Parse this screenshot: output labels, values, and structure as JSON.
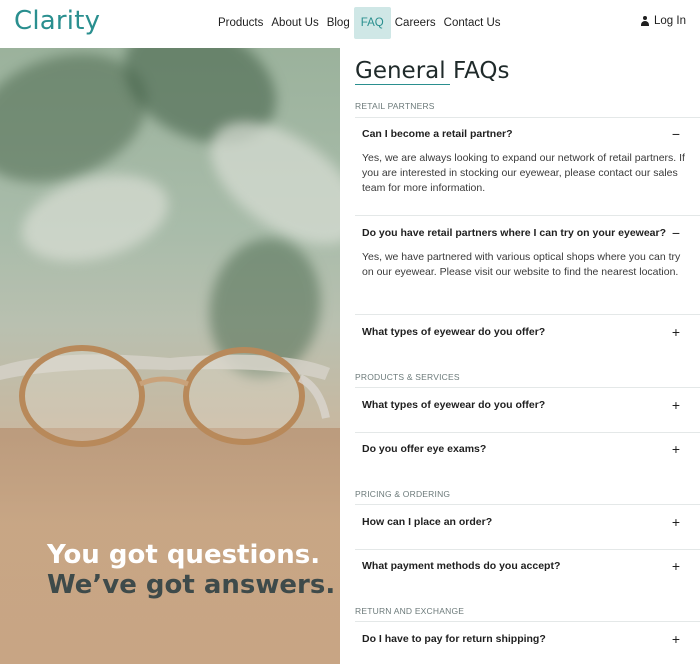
{
  "header": {
    "logo": "Clarity",
    "nav": [
      "Products",
      "About Us",
      "Blog",
      "FAQ",
      "Careers",
      "Contact Us"
    ],
    "active_nav": "FAQ",
    "login": "Log In"
  },
  "hero": {
    "line1": "You got questions.",
    "line2": "We’ve got answers."
  },
  "faq": {
    "title": "General FAQs",
    "sections": [
      {
        "label": "RETAIL PARTNERS",
        "items": [
          {
            "question": "Can I become a retail partner?",
            "expanded": true,
            "toggle": "−",
            "answer": "Yes, we are always looking to expand our network of retail partners. If you are interested in stocking our eyewear, please contact our sales team for more information."
          },
          {
            "question": "Do you have retail partners where I can try on your eyewear?",
            "expanded": true,
            "toggle": "−",
            "answer": "Yes, we have partnered with various optical shops where you can try on our eyewear. Please visit our website to find the nearest location."
          },
          {
            "question": "What types of eyewear do you offer?",
            "expanded": false,
            "toggle": "+"
          }
        ]
      },
      {
        "label": "PRODUCTS & SERVICES",
        "items": [
          {
            "question": "What types of eyewear do you offer?",
            "expanded": false,
            "toggle": "+"
          },
          {
            "question": "Do you offer eye exams?",
            "expanded": false,
            "toggle": "+"
          }
        ]
      },
      {
        "label": "PRICING & ORDERING",
        "items": [
          {
            "question": "How can I place an order?",
            "expanded": false,
            "toggle": "+"
          },
          {
            "question": "What payment methods do you accept?",
            "expanded": false,
            "toggle": "+"
          }
        ]
      },
      {
        "label": "RETURN AND EXCHANGE",
        "items": [
          {
            "question": "Do I have to pay for return shipping?",
            "expanded": false,
            "toggle": "+"
          }
        ]
      }
    ]
  },
  "colors": {
    "brand": "#2a8f8f",
    "nav_active_bg": "#cfe7e6",
    "hero_heading_light": "#ffffff",
    "hero_heading_dark": "#3e4a4a"
  }
}
